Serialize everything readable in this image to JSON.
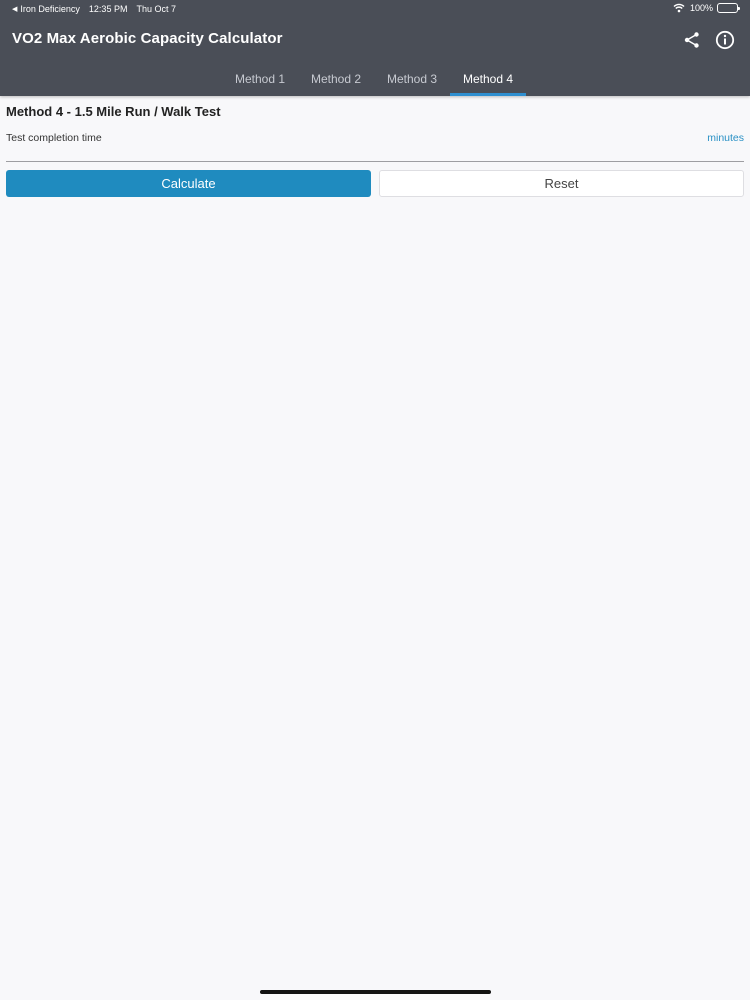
{
  "status_bar": {
    "back_app": "Iron Deficiency",
    "time": "12:35 PM",
    "date": "Thu Oct 7",
    "battery": "100%"
  },
  "header": {
    "title": "VO2 Max Aerobic Capacity Calculator",
    "icons": [
      "share-icon",
      "info-icon"
    ]
  },
  "tabs": [
    "Method 1",
    "Method 2",
    "Method 3",
    "Method 4"
  ],
  "active_tab": "Method 4",
  "section": {
    "title": "Method 4 - 1.5 Mile Run / Walk Test",
    "field_label": "Test completion time",
    "field_value": "",
    "field_unit": "minutes"
  },
  "buttons": {
    "calculate": "Calculate",
    "reset": "Reset"
  },
  "colors": {
    "header_bg": "#4a4e57",
    "accent": "#2f8fd0",
    "calculate_bg": "#1f8bbf",
    "unit_text": "#2a91c5"
  }
}
